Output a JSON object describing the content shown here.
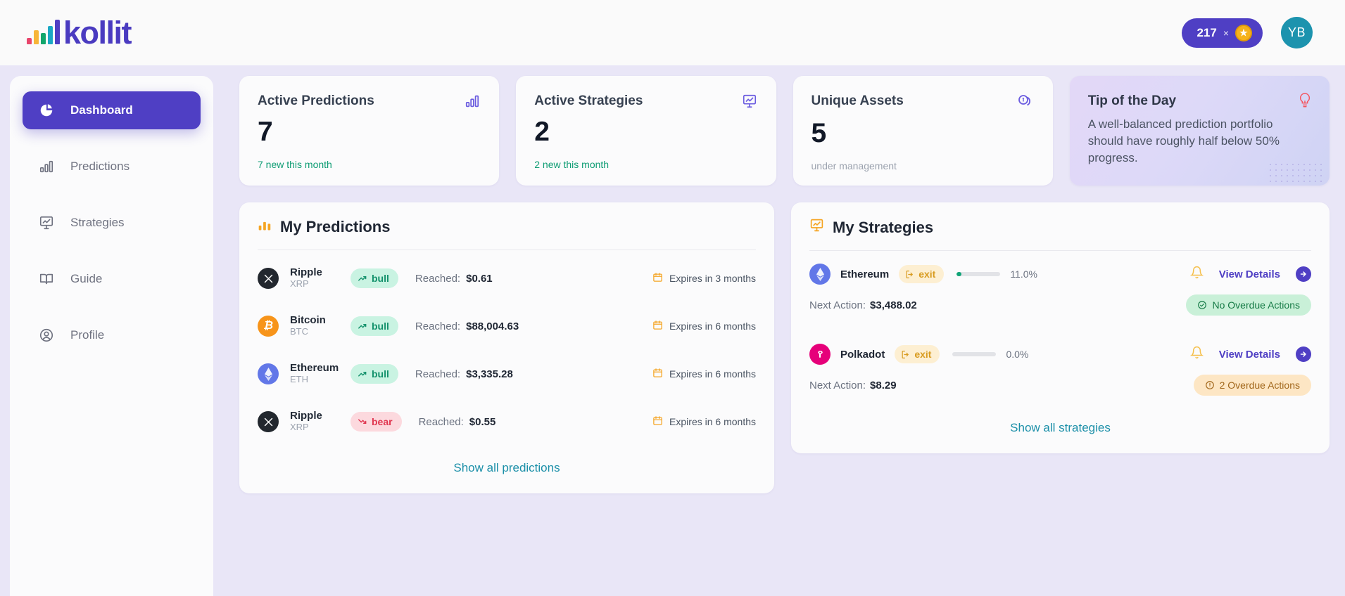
{
  "header": {
    "logo_text": "kollit",
    "coin_count": "217",
    "coin_multiplier": "×",
    "coin_icon": "star-coin-icon",
    "avatar_initials": "YB"
  },
  "sidebar": {
    "items": [
      {
        "label": "Dashboard",
        "icon": "pie-chart-icon",
        "active": true
      },
      {
        "label": "Predictions",
        "icon": "bar-chart-icon",
        "active": false
      },
      {
        "label": "Strategies",
        "icon": "presentation-chart-icon",
        "active": false
      },
      {
        "label": "Guide",
        "icon": "book-open-icon",
        "active": false
      },
      {
        "label": "Profile",
        "icon": "user-circle-icon",
        "active": false
      }
    ]
  },
  "stats": [
    {
      "title": "Active Predictions",
      "value": "7",
      "sub": "7 new this month",
      "sub_tone": "green",
      "icon": "bar-chart-icon"
    },
    {
      "title": "Active Strategies",
      "value": "2",
      "sub": "2 new this month",
      "sub_tone": "green",
      "icon": "presentation-chart-icon"
    },
    {
      "title": "Unique Assets",
      "value": "5",
      "sub": "under management",
      "sub_tone": "gray",
      "icon": "coins-icon"
    }
  ],
  "tip": {
    "title": "Tip of the Day",
    "body": "A well-balanced prediction portfolio should have roughly half below 50% progress.",
    "icon": "lightbulb-icon"
  },
  "predictions_panel": {
    "title": "My Predictions",
    "icon": "bar-chart-icon",
    "reached_label": "Reached:",
    "show_all_label": "Show all predictions",
    "rows": [
      {
        "name": "Ripple",
        "symbol": "XRP",
        "icon": "xrp-icon",
        "direction": "bull",
        "reached": "$0.61",
        "expires": "Expires in 3 months"
      },
      {
        "name": "Bitcoin",
        "symbol": "BTC",
        "icon": "btc-icon",
        "direction": "bull",
        "reached": "$88,004.63",
        "expires": "Expires in 6 months"
      },
      {
        "name": "Ethereum",
        "symbol": "ETH",
        "icon": "eth-icon",
        "direction": "bull",
        "reached": "$3,335.28",
        "expires": "Expires in 6 months"
      },
      {
        "name": "Ripple",
        "symbol": "XRP",
        "icon": "xrp-icon",
        "direction": "bear",
        "reached": "$0.55",
        "expires": "Expires in 6 months"
      }
    ]
  },
  "strategies_panel": {
    "title": "My Strategies",
    "icon": "presentation-chart-icon",
    "next_action_label": "Next Action:",
    "view_details_label": "View Details",
    "show_all_label": "Show all strategies",
    "rows": [
      {
        "name": "Ethereum",
        "icon": "eth-icon",
        "tag": "exit",
        "progress_pct": "11.0%",
        "progress_value": 11,
        "next_action": "$3,488.02",
        "status_text": "No Overdue Actions",
        "status_tone": "ok",
        "status_icon": "check-circle-icon"
      },
      {
        "name": "Polkadot",
        "icon": "dot-icon",
        "tag": "exit",
        "progress_pct": "0.0%",
        "progress_value": 0,
        "next_action": "$8.29",
        "status_text": "2 Overdue Actions",
        "status_tone": "warn",
        "status_icon": "alert-circle-icon"
      }
    ]
  },
  "colors": {
    "brand_purple": "#4f3fc4",
    "background": "#e9e6f7",
    "green": "#0f9d74",
    "red": "#e0354f",
    "amber": "#d89b1f",
    "teal_link": "#1b8fa8"
  }
}
